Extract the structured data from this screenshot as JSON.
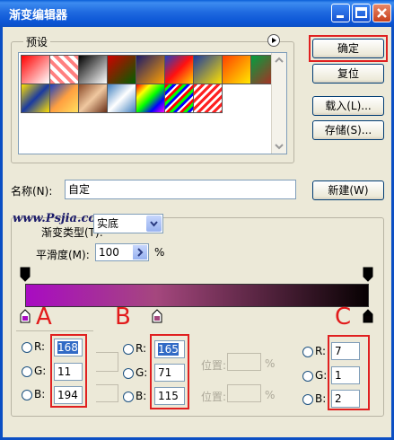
{
  "window": {
    "title": "渐变编辑器"
  },
  "presets": {
    "label": "预设",
    "swatches": [
      "linear-gradient(135deg,#ff0000,#ffffff)",
      "repeating-linear-gradient(45deg,#ff8080 0 4px,#fff 4px 8px)",
      "linear-gradient(135deg,#000000,#ffffff)",
      "linear-gradient(135deg,#d00000,#006000)",
      "linear-gradient(135deg,#1a1a6a,#ffa000)",
      "linear-gradient(135deg,#2040c0,#ff1010,#ffd000)",
      "linear-gradient(135deg,#1a3aa0,#ffe000)",
      "linear-gradient(135deg,#ff4000,#ffe800)",
      "linear-gradient(135deg,#00a040,#c02020)",
      "linear-gradient(135deg,#ffe000,#1a3aa0,#ffe000)",
      "linear-gradient(135deg,#1a40c0,#ffa040,#ffe060)",
      "linear-gradient(135deg,#8a4a28,#f0c8a0,#6a3018)",
      "linear-gradient(135deg,#4080c0,#ffffff,#4080c0)",
      "linear-gradient(135deg,#ff0000,#ffff00,#00ff00,#0000ff,#ff00ff)",
      "repeating-linear-gradient(135deg,#ff0000 0 3px,#00ff00 3px 6px,#0000ff 6px 9px,#fff 9px 11px)",
      "repeating-linear-gradient(135deg,#ff2020 0 3px,#fff 3px 6px)"
    ]
  },
  "buttons": {
    "ok": "确定",
    "reset": "复位",
    "load": "载入(L)...",
    "save": "存储(S)...",
    "new": "新建(W)"
  },
  "name_field": {
    "label": "名称(N):",
    "value": "自定"
  },
  "watermark": "www.Psjia.com",
  "gradient_type": {
    "label": "渐变类型(T):",
    "value": "实底"
  },
  "smoothness": {
    "label": "平滑度(M):",
    "value": "100",
    "unit": "%"
  },
  "gradient_bar": {
    "fill": "linear-gradient(to right,#a80bc2 0%,#a5477e 38%,#070102 100%)"
  },
  "markers": {
    "a": "A",
    "b": "B",
    "c": "C"
  },
  "stops": {
    "a": {
      "r": "168",
      "g": "11",
      "b": "194"
    },
    "b": {
      "r": "165",
      "g": "71",
      "b": "115"
    },
    "c": {
      "r": "7",
      "g": "1",
      "b": "2"
    }
  },
  "channel_labels": {
    "r": "R:",
    "g": "G:",
    "b": "B:"
  },
  "location": {
    "label": "位置:",
    "unit": "%"
  },
  "colors": {
    "highlight": "#e02020",
    "accent": "#0b4fc4"
  }
}
